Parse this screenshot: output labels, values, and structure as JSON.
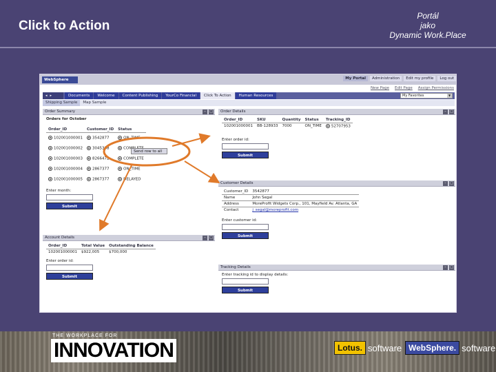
{
  "slide": {
    "title": "Click to Action",
    "right_title": [
      "Portál",
      "jako",
      "Dynamic Work.Place"
    ]
  },
  "portal": {
    "logo": "WebSphere",
    "logo_sub": "Portal",
    "top_links": [
      "My Portal",
      "Administration",
      "Edit my profile",
      "Log out"
    ],
    "sub_links": [
      "New Page",
      "Edit Page",
      "Assign Permissions"
    ],
    "tabs": [
      "Documents",
      "Welcome",
      "Content Publishing",
      "YourCo Financial",
      "Click To Action",
      "Human Resources"
    ],
    "active_tab": "Click To Action",
    "favorites": "My Favorites",
    "subtabs": [
      "Shipping Sample",
      "Map Sample"
    ],
    "order_summary": {
      "title": "Order Summary",
      "heading": "Orders for October",
      "columns": [
        "Order_ID",
        "Customer_ID",
        "Status"
      ],
      "rows": [
        [
          "102001000001",
          "3542877",
          "ON_TIME"
        ],
        [
          "102001000002",
          "3045388",
          "COMPLETE"
        ],
        [
          "102001000003",
          "8266472",
          "COMPLETE"
        ],
        [
          "102001000004",
          "2867377",
          "ON_TIME"
        ],
        [
          "102001000005",
          "2867377",
          "DELAYED"
        ]
      ],
      "popup": "Send row to all",
      "field_label": "Enter month:",
      "submit": "Submit"
    },
    "account_details": {
      "title": "Account Details",
      "columns": [
        "Order_ID",
        "Total Value",
        "Outstanding Balance"
      ],
      "row": [
        "102001000001",
        "$922,005",
        "$700,000"
      ],
      "field_label": "Enter order id:",
      "submit": "Submit"
    },
    "order_details": {
      "title": "Order Details",
      "columns": [
        "Order_ID",
        "SKU",
        "Quantity",
        "Status",
        "Tracking_ID"
      ],
      "row": [
        "102001000001",
        "BB-128933",
        "7000",
        "ON_TIME",
        "52707953"
      ],
      "field_label": "Enter order id:",
      "submit": "Submit"
    },
    "customer_details": {
      "title": "Customer Details",
      "rows": [
        [
          "Customer_ID",
          "3542877"
        ],
        [
          "Name",
          "John Segal"
        ],
        [
          "Address",
          "MoreProfit Widgets Corp., 101, Mayfield Av. Atlanta, GA"
        ],
        [
          "Contact",
          "j_segal@moreprofit.com"
        ]
      ],
      "field_label": "Enter customer id:",
      "submit": "Submit"
    },
    "tracking_details": {
      "title": "Tracking Details",
      "field_label": "Enter tracking id to display details:",
      "submit": "Submit"
    }
  },
  "branding": {
    "tagline": "THE WORKPLACE FOR",
    "innovation": "INNOVATION",
    "lotus": "Lotus.",
    "websphere": "WebSphere.",
    "software": "software"
  },
  "colors": {
    "background": "#4a4373",
    "annotation": "#e07a2a",
    "tab_blue": "#2f3c9a"
  }
}
